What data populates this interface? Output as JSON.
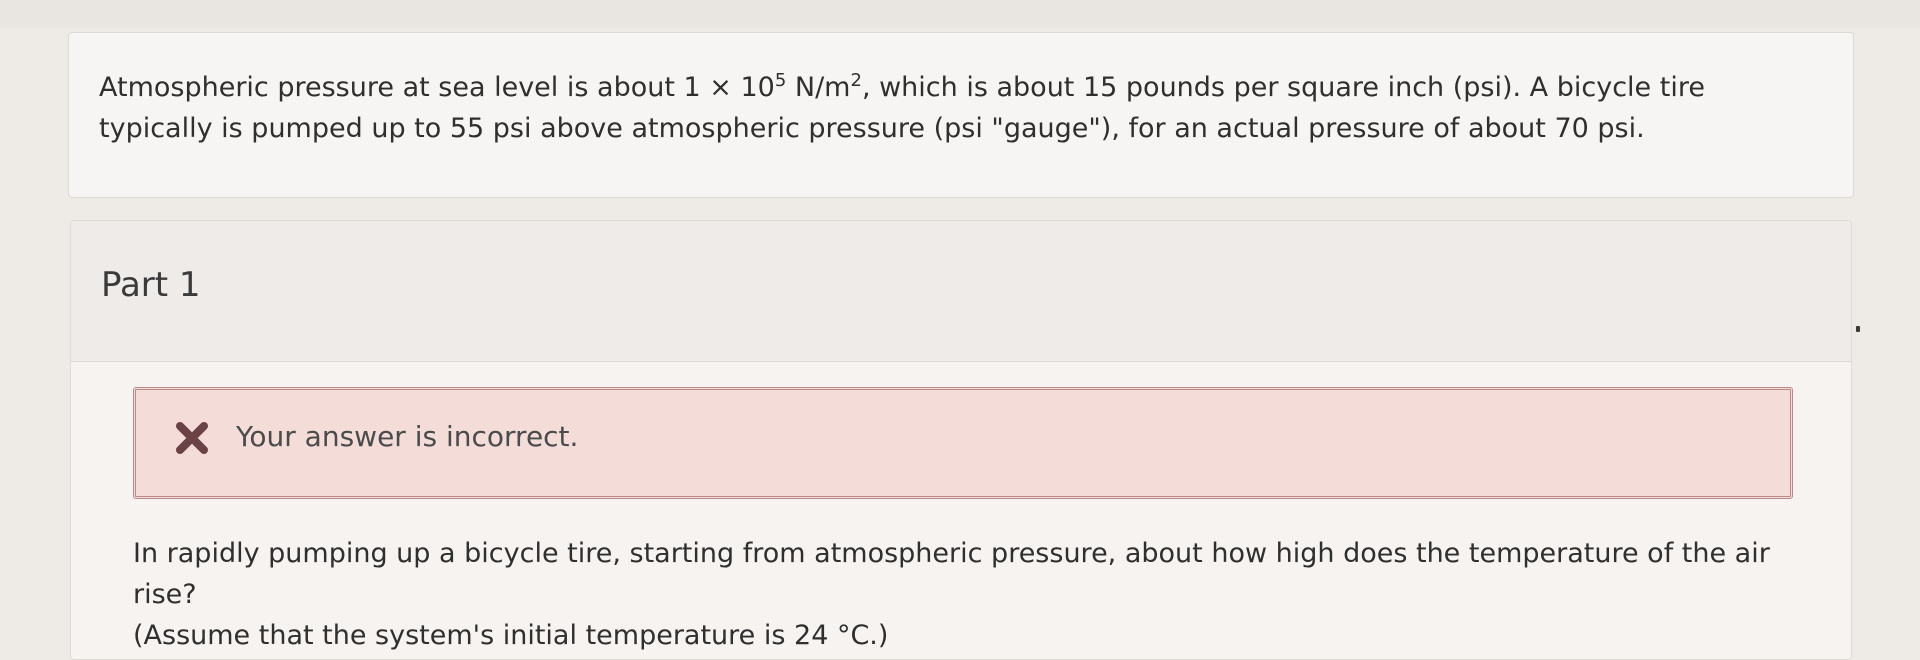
{
  "intro": {
    "text_a": "Atmospheric pressure at sea level is about 1 × 10",
    "exp_a": "5",
    "text_b": " N/m",
    "exp_b": "2",
    "text_c": ", which is about 15 pounds per square inch (psi). A bicycle tire typically is pumped up to 55 psi above atmospheric pressure (psi \"gauge\"), for an actual pressure of about 70 psi."
  },
  "part": {
    "title": "Part 1"
  },
  "alert": {
    "icon": "x-mark-icon",
    "message": "Your answer is incorrect."
  },
  "question": {
    "line1": "In rapidly pumping up a bicycle tire, starting from atmospheric pressure, about how high does the temperature of the air rise?",
    "line2": "(Assume that the system's initial temperature is 24 °C.)"
  },
  "colors": {
    "alert_background": "#f4dcd9",
    "alert_border": "#b9898a",
    "alert_icon": "#6b4346"
  }
}
